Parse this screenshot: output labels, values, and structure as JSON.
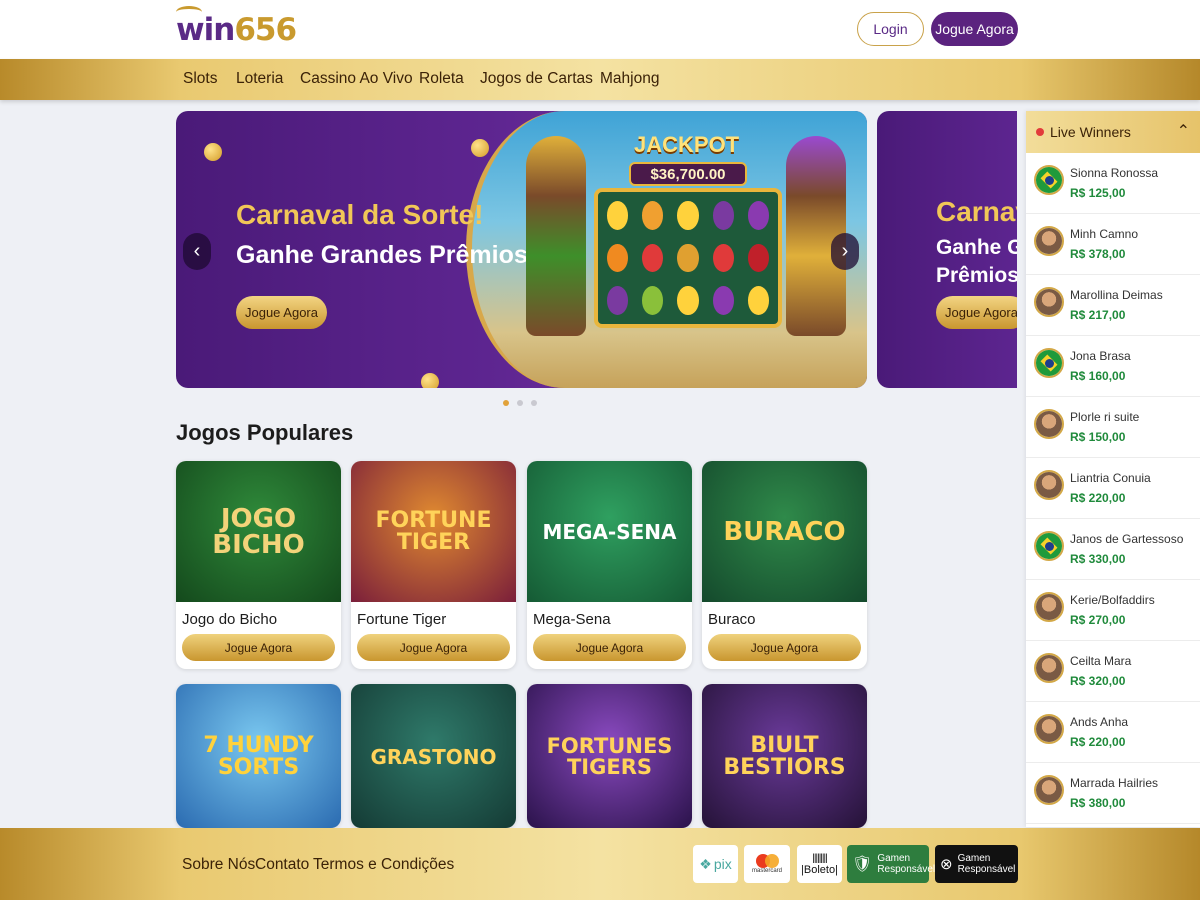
{
  "header": {
    "logo_text_main": "win",
    "logo_text_num": "656",
    "login_label": "Login",
    "play_label": "Jogue Agora"
  },
  "nav": {
    "items": [
      "Slots",
      "Loteria",
      "Cassino Ao Vivo",
      "Roleta",
      "Jogos de Cartas",
      "Mahjong"
    ]
  },
  "banner": {
    "title_line1": "Carnaval da Sorte!",
    "title_line2": "Ganhe Grandes Prêmios!",
    "cta": "Jogue Agora",
    "jackpot_label": "JACKPOT",
    "jackpot_amount": "$36,700.00",
    "prev_icon": "chevron-left-icon",
    "next_icon": "chevron-right-icon",
    "slide_count": 3,
    "active_slide": 1
  },
  "banner_next": {
    "title_line1": "Carnaval",
    "title_line2": "Ganhe Gr Prêmios!",
    "cta": "Jogue Agora"
  },
  "popular": {
    "title": "Jogos Populares",
    "games": [
      {
        "name": "Jogo do Bicho",
        "thumb_text": "JOGO BICHO",
        "cta": "Jogue Agora",
        "bg": "#1f6a2a",
        "text_color": "#f3d37a"
      },
      {
        "name": "Fortune Tiger",
        "thumb_text": "FORTUNE TIGER",
        "cta": "Jogue Agora",
        "bg": "#9b2a1e",
        "text_color": "#ffd35a"
      },
      {
        "name": "Mega-Sena",
        "thumb_text": "MEGA-SENA",
        "cta": "Jogue Agora",
        "bg": "#1d7a48",
        "text_color": "#ffffff"
      },
      {
        "name": "Buraco",
        "thumb_text": "BURACO",
        "cta": "Jogue Agora",
        "bg": "#1e6b3c",
        "text_color": "#ffd35a"
      }
    ],
    "games_row2": [
      {
        "thumb_text": "7 HUNDY SORTS",
        "bg": "#3b8fd6",
        "text_color": "#ffd23c"
      },
      {
        "thumb_text": "GRASTONO",
        "bg": "#1f5a52",
        "text_color": "#ffd35a"
      },
      {
        "thumb_text": "FORTUNES TIGERS",
        "bg": "#4a1a78",
        "text_color": "#ffd35a"
      },
      {
        "thumb_text": "BIULT BESTIORS",
        "bg": "#3c1f5e",
        "text_color": "#ffd35a"
      }
    ]
  },
  "winners": {
    "title": "Live Winners",
    "toggle_icon": "chevron-up-icon",
    "list": [
      {
        "name": "Sionna Ronossa",
        "amount": "R$ 125,00",
        "avatar": "flag"
      },
      {
        "name": "Minh Camno",
        "amount": "R$ 378,00",
        "avatar": "face"
      },
      {
        "name": "Marollina Deimas",
        "amount": "R$ 217,00",
        "avatar": "face"
      },
      {
        "name": "Jona Brasa",
        "amount": "R$ 160,00",
        "avatar": "flag"
      },
      {
        "name": "Plorle ri suite",
        "amount": "R$ 150,00",
        "avatar": "face"
      },
      {
        "name": "Liantria Conuia",
        "amount": "R$ 220,00",
        "avatar": "face"
      },
      {
        "name": "Janos de Gartessoso",
        "amount": "R$ 330,00",
        "avatar": "flag"
      },
      {
        "name": "Kerie/Bolfaddirs",
        "amount": "R$ 270,00",
        "avatar": "face"
      },
      {
        "name": "Ceilta Mara",
        "amount": "R$ 320,00",
        "avatar": "face"
      },
      {
        "name": "Ands Anha",
        "amount": "R$ 220,00",
        "avatar": "face"
      },
      {
        "name": "Marrada Hailries",
        "amount": "R$ 380,00",
        "avatar": "face"
      }
    ]
  },
  "footer": {
    "links": [
      "Sobre Nós",
      "Contato",
      "Termos e Condições"
    ],
    "payments": {
      "pix": "pix",
      "mastercard": "mastercard",
      "boleto": "|Boleto|",
      "responsible1_line1": "Gamen",
      "responsible1_line2": "Responsável",
      "responsible2_line1": "Gamen",
      "responsible2_line2": "Responsável"
    }
  },
  "colors": {
    "brand_purple": "#5b237f",
    "gold": "#e6c36a",
    "win_green": "#1f8a3b"
  }
}
